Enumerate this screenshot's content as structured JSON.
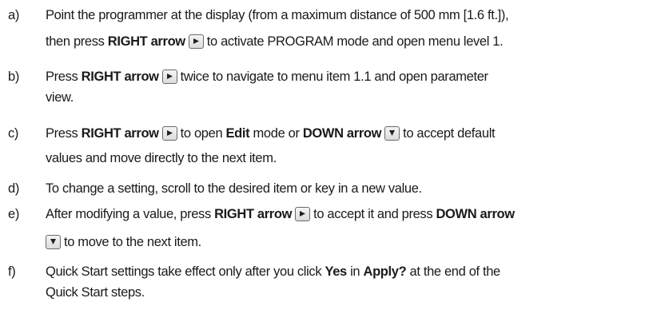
{
  "steps": [
    {
      "marker": "a)",
      "lines": [
        [
          {
            "t": "Point the programmer at the display (from a maximum distance of 500 mm [1.6 ft.]),"
          }
        ],
        [
          {
            "t": "then press "
          },
          {
            "b": "RIGHT arrow"
          },
          {
            "k": "right-arrow-key"
          },
          {
            "t": "to activate PROGRAM mode and open menu level 1."
          }
        ]
      ]
    },
    {
      "marker": "b)",
      "lines": [
        [
          {
            "t": "Press "
          },
          {
            "b": "RIGHT arrow"
          },
          {
            "k": "right-arrow-key"
          },
          {
            "t": "twice to navigate to menu item 1.1 and open parameter"
          }
        ],
        [
          {
            "t": "view."
          }
        ]
      ]
    },
    {
      "marker": "c)",
      "lines": [
        [
          {
            "t": "Press "
          },
          {
            "b": "RIGHT arrow"
          },
          {
            "k": "right-arrow-key"
          },
          {
            "t": "to open "
          },
          {
            "b": "Edit"
          },
          {
            "t": " mode or "
          },
          {
            "b": "DOWN arrow"
          },
          {
            "k": "down-arrow-key"
          },
          {
            "t": "to accept default"
          }
        ],
        [
          {
            "t": "values and move directly to the next item."
          }
        ]
      ]
    },
    {
      "marker": "d)",
      "lines": [
        [
          {
            "t": "To change a setting, scroll to the desired item or key in a new value."
          }
        ]
      ]
    },
    {
      "marker": "e)",
      "lines": [
        [
          {
            "t": "After modifying a value, press "
          },
          {
            "b": "RIGHT arrow"
          },
          {
            "k": "right-arrow-key"
          },
          {
            "t": "to accept it and press "
          },
          {
            "b": "DOWN arrow"
          }
        ],
        [
          {
            "k": "down-arrow-key"
          },
          {
            "t": "to move to the next item."
          }
        ]
      ]
    },
    {
      "marker": "f)",
      "lines": [
        [
          {
            "t": "Quick Start settings take effect only after you click "
          },
          {
            "b": "Yes"
          },
          {
            "t": " in "
          },
          {
            "b": "Apply?"
          },
          {
            "t": " at the end of the"
          }
        ],
        [
          {
            "t": "Quick Start steps."
          }
        ]
      ]
    }
  ]
}
